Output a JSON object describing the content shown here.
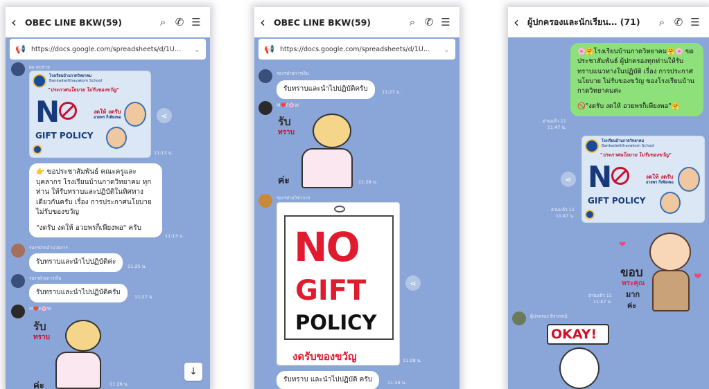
{
  "phones": [
    {
      "title": "OBEC LINE BKW(59)",
      "url": "https://docs.google.com/spreadsheets/d/1U…",
      "messages": {
        "poster_sender": "ผอ.สมชาย",
        "poster_time": "11:13 น.",
        "poster_school": "โรงเรียนบ้านกาดวิทยาคม",
        "poster_school_en": "Bankadwitthayakom School",
        "poster_slogan": "\"ประกาศนโยบาย ไม่รับของขวัญ\"",
        "poster_n": "N",
        "poster_gift": "GIFT POLICY",
        "poster_badge": "งดให้ งดรับ",
        "poster_badge2": "อวยพร ก็เพียงพอ",
        "text_msg": "👉 ขอประชาสัมพันธ์ คณะครูและบุคลากร โรงเรียนบ้านกาดวิทยาคม ทุกท่าน ให้รับทราบและปฏิบัติในทิศทางเดียวกันครับ เรื่อง การประกาศนโยบาย ไม่รับของขวัญ",
        "text_msg2": "\"งดรับ งดให้ อวยพรก็เพียงพอ\" ครับ",
        "text_time": "11:13 น.",
        "m3_sender": "รองฯฝ่ายอำนวยการ",
        "m3_text": "รับทราบและนำไปปฏิบัติค่ะ",
        "m3_time": "11:25 น.",
        "m4_sender": "รองฯฝ่ายการเงิน",
        "m4_text": "รับทราบและนำไปปฏิบัติครับ",
        "m4_time": "11:27 น.",
        "m5_sender": "M❤️E🌸W",
        "sticker_word": "รับ",
        "sticker_word2": "ทราบ",
        "sticker_kha": "ค่ะ",
        "m5_time": "11:28 น."
      }
    },
    {
      "title": "OBEC LINE BKW(59)",
      "url": "https://docs.google.com/spreadsheets/d/1U…",
      "messages": {
        "m1_sender": "รองฯฝ่ายการเงิน",
        "m1_text": "รับทราบและนำไปปฏิบัติครับ",
        "m1_time": "11:27 น.",
        "m2_sender": "M❤️E🌸W",
        "sticker_word": "รับ",
        "sticker_word2": "ทราบ",
        "sticker_kha": "ค่ะ",
        "m2_time": "11:28 น.",
        "m3_sender": "รองฯฝ่ายวิชาการ",
        "no": "NO",
        "gift": "GIFT",
        "policy": "POLICY",
        "no_sub": "งดรับของขวัญ",
        "m3_time": "11:28 น.",
        "m4_text": "รับทราบ และนำไปปฏิบัติ ครับ",
        "m4_time": "11:28 น."
      }
    },
    {
      "title": "ผู้ปกครองและนักเรียน… (71)",
      "messages": {
        "g_text": "🌸🤗โรงเรียนบ้านกาดวิทยาคม🤗🌸 ขอประชาสัมพันธ์ ผู้ปกครองทุกท่านให้รับทราบแนวทางในปฏิบัติ เรื่อง การประกาศนโยบาย ไม่รับของขวัญ ของโรงเรียนบ้านกาดวิทยาคมค่ะ",
        "g_text2": "🚫\"งดรับ งดให้ อวยพรก็เพียงพอ\"🤗",
        "g_read": "อ่านแล้ว 11",
        "g_time": "11:47 น.",
        "poster_read": "อ่านแล้ว 11",
        "poster_time": "11:47 น.",
        "sticker_read": "อ่านแล้ว 11",
        "sticker_time": "11:47 น.",
        "thanks1": "ขอบ",
        "thanks2": "พระคุณ",
        "thanks3": "มาก",
        "thanks4": "ค่ะ",
        "m4_sender": "ผู้ปกครอง ธิรากรณ์",
        "okay": "OKAY!"
      }
    }
  ],
  "icons": [
    "back-icon",
    "search-icon",
    "phone-icon",
    "menu-icon",
    "megaphone-icon",
    "chevron-down-icon",
    "share-icon",
    "scroll-down-icon"
  ],
  "colors": {
    "chat_bg": "#8aa6d8",
    "bubble_green": "#8ee07b",
    "brand_red": "#c8102e",
    "brand_navy": "#173a7a"
  }
}
